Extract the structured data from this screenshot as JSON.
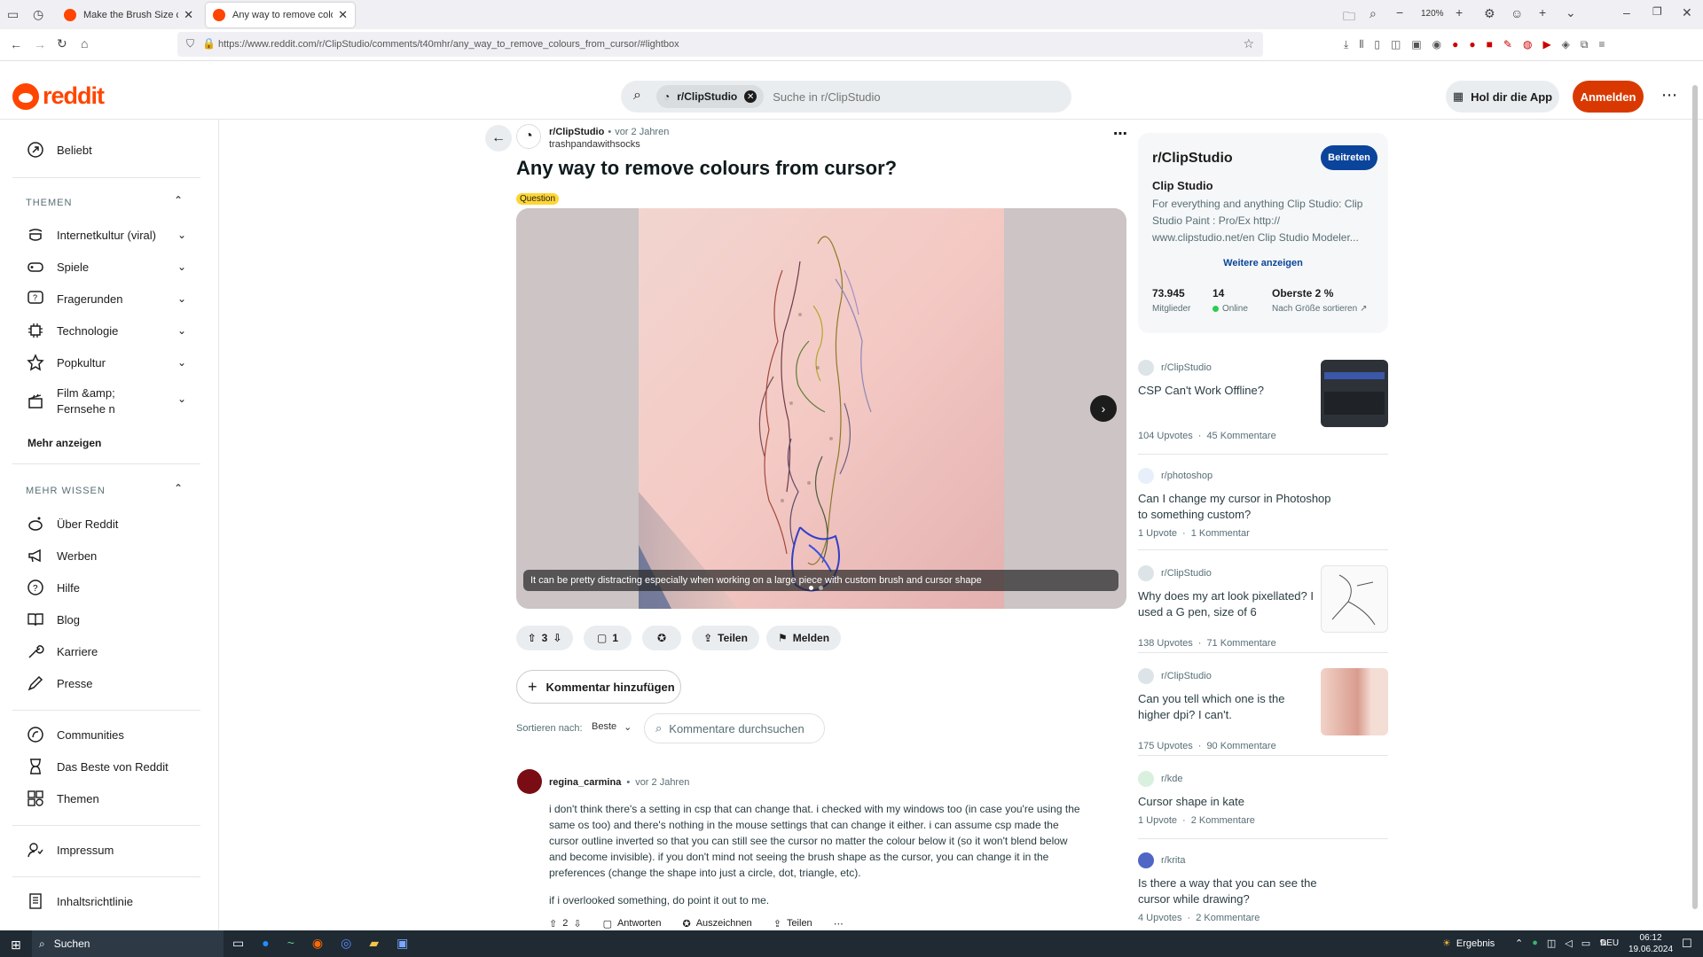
{
  "browser": {
    "tabs": [
      {
        "title": "Make the Brush Size cursor not",
        "active": false
      },
      {
        "title": "Any way to remove colours fro",
        "active": true
      }
    ],
    "url": "https://www.reddit.com/r/ClipStudio/comments/t40mhr/any_way_to_remove_colours_from_cursor/#lightbox",
    "zoom": "120%"
  },
  "header": {
    "logo_text": "reddit",
    "search_chip": "r/ClipStudio",
    "search_placeholder": "Suche in r/ClipStudio",
    "get_app": "Hol dir die App",
    "login": "Anmelden"
  },
  "sidebar": {
    "popular": "Beliebt",
    "topics_heading": "THEMEN",
    "topics": [
      "Internetkultur (viral)",
      "Spiele",
      "Fragerunden",
      "Technologie",
      "Popkultur",
      "Film &amp; Fernsehe n"
    ],
    "show_more": "Mehr anzeigen",
    "more_heading": "MEHR WISSEN",
    "more": [
      "Über Reddit",
      "Werben",
      "Hilfe",
      "Blog",
      "Karriere",
      "Presse"
    ],
    "extra": [
      "Communities",
      "Das Beste von Reddit",
      "Themen"
    ],
    "legal": [
      "Impressum",
      "Inhaltsrichtlinie"
    ]
  },
  "post": {
    "subreddit": "r/ClipStudio",
    "age": "vor 2 Jahren",
    "author": "trashpandawithsocks",
    "title": "Any way to remove colours from cursor?",
    "flair": "Question",
    "caption": "It can be pretty distracting especially when working on a large piece with custom brush and cursor shape",
    "votes": "3",
    "comments": "1",
    "share": "Teilen",
    "report": "Melden",
    "add_comment": "Kommentar hinzufügen",
    "sort_label": "Sortieren nach:",
    "sort_value": "Beste",
    "comment_search_placeholder": "Kommentare durchsuchen"
  },
  "comment": {
    "author": "regina_carmina",
    "age": "vor 2 Jahren",
    "p1": "i don't think there's a setting in csp that can change that. i checked with my windows too (in case you're using the same os too) and there's nothing in the mouse settings that can change it either. i can assume csp made the cursor outline inverted so that you can still see the cursor no matter the colour below it (so it won't blend below and become invisible). if you don't mind not seeing the brush shape as the cursor, you can change it in the preferences (change the shape into just a circle, dot, triangle, etc).",
    "p2": "if i overlooked something, do point it out to me.",
    "votes": "2",
    "reply": "Antworten",
    "award": "Auszeichnen",
    "share": "Teilen"
  },
  "community": {
    "name": "r/ClipStudio",
    "join": "Beitreten",
    "title": "Clip Studio",
    "description": "For everything and anything Clip Studio: Clip Studio Paint : Pro/Ex http:// www.clipstudio.net/en Clip Studio Modeler...",
    "show_more": "Weitere anzeigen",
    "members": "73.945",
    "members_label": "Mitglieder",
    "online": "14",
    "online_label": "Online",
    "rank": "Oberste 2 %",
    "rank_label": "Nach Größe sortieren"
  },
  "related": [
    {
      "sub": "r/ClipStudio",
      "title": "CSP Can't Work Offline?",
      "upvotes": "104 Upvotes",
      "comments": "45 Kommentare"
    },
    {
      "sub": "r/photoshop",
      "title": "Can I change my cursor in Photoshop to something custom?",
      "upvotes": "1 Upvote",
      "comments": "1 Kommentar"
    },
    {
      "sub": "r/ClipStudio",
      "title": "Why does my art look pixellated? I used a G pen, size of 6",
      "upvotes": "138 Upvotes",
      "comments": "71 Kommentare"
    },
    {
      "sub": "r/ClipStudio",
      "title": "Can you tell which one is the higher dpi? I can't.",
      "upvotes": "175 Upvotes",
      "comments": "90 Kommentare"
    },
    {
      "sub": "r/kde",
      "title": "Cursor shape in kate",
      "upvotes": "1 Upvote",
      "comments": "2 Kommentare"
    },
    {
      "sub": "r/krita",
      "title": "Is there a way that you can see the cursor while drawing?",
      "upvotes": "4 Upvotes",
      "comments": "2 Kommentare"
    }
  ],
  "taskbar": {
    "search": "Suchen",
    "result": "Ergebnis",
    "lang": "DEU",
    "time": "06:12",
    "date": "19.06.2024"
  },
  "colors": {
    "brand": "#ff4500",
    "join": "#0a449b",
    "flair": "#ffd635"
  }
}
